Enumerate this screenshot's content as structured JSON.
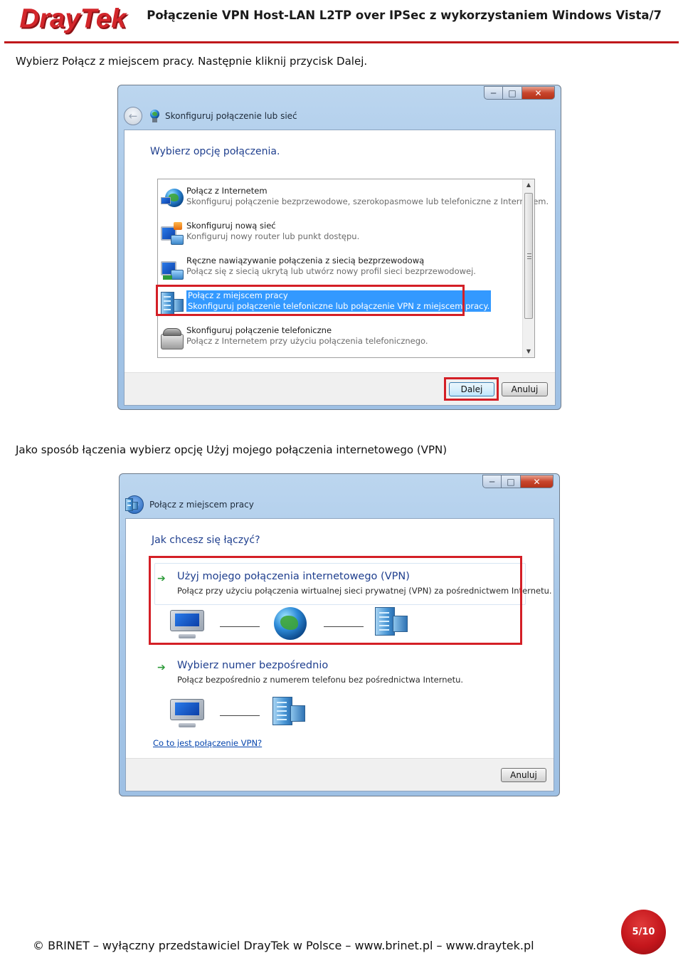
{
  "header": {
    "logo_text": "DrayTek",
    "title": "Połączenie VPN Host-LAN L2TP over IPSec  z wykorzystaniem Windows Vista/7"
  },
  "instructions": [
    "Wybierz Połącz z miejscem pracy. Następnie kliknij przycisk Dalej.",
    "Jako sposób łączenia wybierz opcję Użyj mojego połączenia internetowego (VPN)"
  ],
  "dialog1": {
    "caption_buttons": {
      "minimize": "─",
      "maximize": "□",
      "close": "✕"
    },
    "nav_title": "Skonfiguruj połączenie lub sieć",
    "heading": "Wybierz opcję połączenia.",
    "options": [
      {
        "title": "Połącz z Internetem",
        "desc": "Skonfiguruj połączenie bezprzewodowe, szerokopasmowe lub telefoniczne z Internetem.",
        "icon": "globe-network-icon"
      },
      {
        "title": "Skonfiguruj nową sieć",
        "desc": "Konfiguruj nowy router lub punkt dostępu.",
        "icon": "new-network-icon"
      },
      {
        "title": "Ręczne nawiązywanie połączenia z siecią bezprzewodową",
        "desc": "Połącz się z siecią ukrytą lub utwórz nowy profil sieci bezprzewodowej.",
        "icon": "wireless-network-icon"
      },
      {
        "title": "Połącz z miejscem pracy",
        "desc": "Skonfiguruj połączenie telefoniczne lub połączenie VPN z miejscem pracy.",
        "icon": "workplace-icon"
      },
      {
        "title": "Skonfiguruj połączenie telefoniczne",
        "desc": "Połącz z Internetem przy użyciu połączenia telefonicznego.",
        "icon": "phone-icon"
      }
    ],
    "selected_index": 3,
    "scroll_up": "▲",
    "scroll_down": "▼",
    "next_button": "Dalej",
    "cancel_button": "Anuluj"
  },
  "dialog2": {
    "caption_buttons": {
      "minimize": "─",
      "maximize": "□",
      "close": "✕"
    },
    "nav_title": "Połącz z miejscem pracy",
    "heading": "Jak chcesz się łączyć?",
    "options": [
      {
        "arrow": "➔",
        "title": "Użyj mojego połączenia internetowego (VPN)",
        "desc": "Połącz przy użyciu połączenia wirtualnej sieci prywatnej (VPN) za pośrednictwem Internetu."
      },
      {
        "arrow": "➔",
        "title": "Wybierz numer bezpośrednio",
        "desc": "Połącz bezpośrednio z numerem telefonu bez pośrednictwa Internetu."
      }
    ],
    "help_link": "Co to jest połączenie VPN?",
    "cancel_button": "Anuluj"
  },
  "footer": {
    "copyright": "© BRINET – wyłączny przedstawiciel DrayTek w Polsce – www.brinet.pl – www.draytek.pl",
    "page": "5/10"
  },
  "colors": {
    "accent_red": "#c0181b",
    "highlight_box": "#d41f26",
    "selection_blue": "#3399ff",
    "heading_blue": "#1f3f8e"
  }
}
